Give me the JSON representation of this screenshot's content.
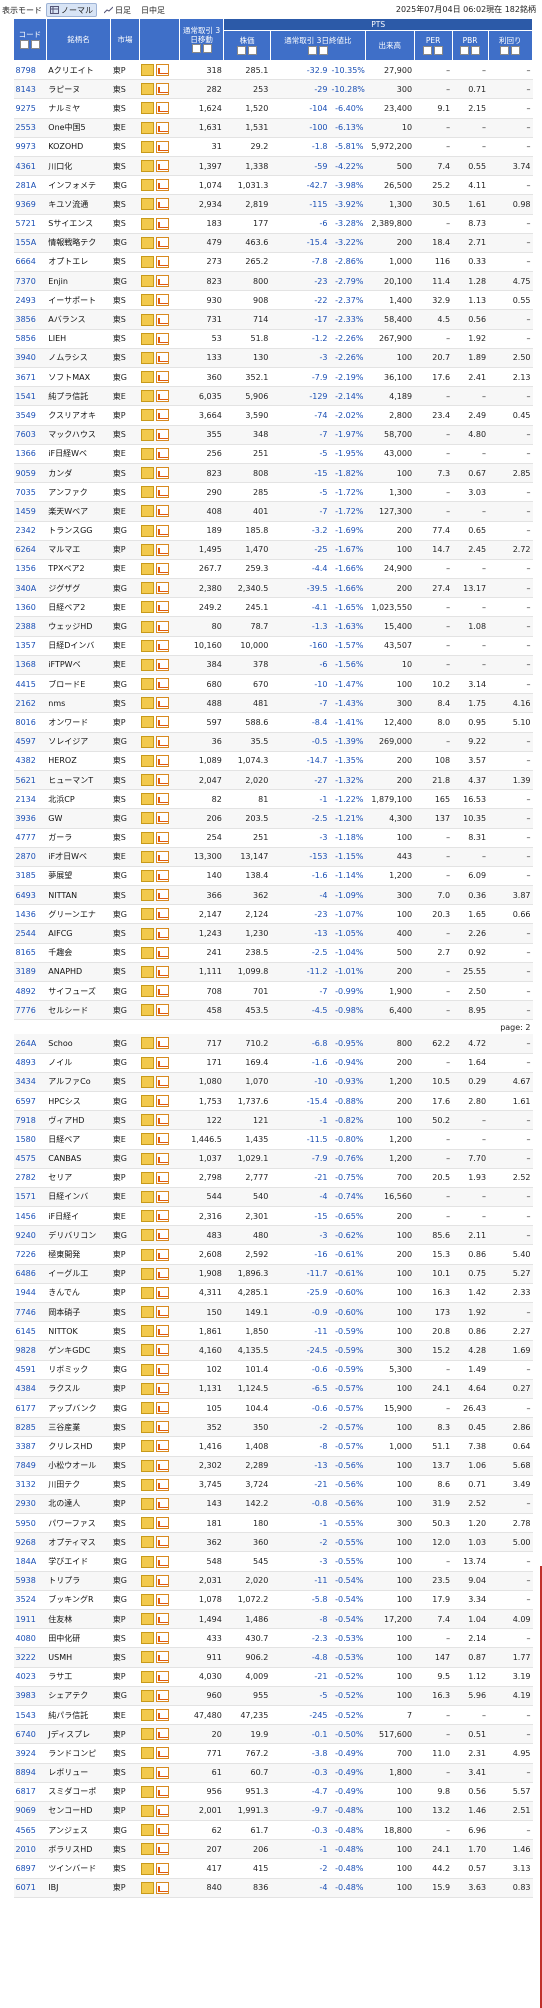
{
  "header": {
    "display_mode_label": "表示モード",
    "modes": [
      "ノーマル",
      "日足",
      "日中足"
    ],
    "datetime": "2025年07月04日 06:02現在 182銘柄"
  },
  "columns": {
    "code": "コード",
    "name": "銘柄名",
    "market": "市場",
    "vol3": "通常取引 3日移動",
    "price": "株価",
    "pts": "PTS",
    "ratio": "通常取引 3日終値比",
    "volume": "出来高",
    "per": "PER",
    "pbr": "PBR",
    "yield": "利回り"
  },
  "page_label": "page: 2",
  "rows": [
    [
      "8798",
      "Aクリエイト",
      "東P",
      "318",
      "285.1",
      "-32.9",
      "-10.35%",
      "27,900",
      "–",
      "–",
      "–"
    ],
    [
      "8143",
      "ラピーヌ",
      "東S",
      "282",
      "253",
      "-29",
      "-10.28%",
      "300",
      "–",
      "0.71",
      "–"
    ],
    [
      "9275",
      "ナルミヤ",
      "東S",
      "1,624",
      "1,520",
      "-104",
      "-6.40%",
      "23,400",
      "9.1",
      "2.15",
      "–"
    ],
    [
      "2553",
      "One中国5",
      "東E",
      "1,631",
      "1,531",
      "-100",
      "-6.13%",
      "10",
      "–",
      "–",
      "–"
    ],
    [
      "9973",
      "KOZOHD",
      "東S",
      "31",
      "29.2",
      "-1.8",
      "-5.81%",
      "5,972,200",
      "–",
      "–",
      "–"
    ],
    [
      "4361",
      "川口化",
      "東S",
      "1,397",
      "1,338",
      "-59",
      "-4.22%",
      "500",
      "7.4",
      "0.55",
      "3.74"
    ],
    [
      "281A",
      "インフォメテ",
      "東G",
      "1,074",
      "1,031.3",
      "-42.7",
      "-3.98%",
      "26,500",
      "25.2",
      "4.11",
      "–"
    ],
    [
      "9369",
      "キユソ流通",
      "東S",
      "2,934",
      "2,819",
      "-115",
      "-3.92%",
      "1,300",
      "30.5",
      "1.61",
      "0.98"
    ],
    [
      "5721",
      "Sサイエンス",
      "東S",
      "183",
      "177",
      "-6",
      "-3.28%",
      "2,389,800",
      "–",
      "8.73",
      "–"
    ],
    [
      "155A",
      "情報戦略テク",
      "東G",
      "479",
      "463.6",
      "-15.4",
      "-3.22%",
      "200",
      "18.4",
      "2.71",
      "–"
    ],
    [
      "6664",
      "オプトエレ",
      "東S",
      "273",
      "265.2",
      "-7.8",
      "-2.86%",
      "1,000",
      "116",
      "0.33",
      "–"
    ],
    [
      "7370",
      "Enjin",
      "東G",
      "823",
      "800",
      "-23",
      "-2.79%",
      "20,100",
      "11.4",
      "1.28",
      "4.75"
    ],
    [
      "2493",
      "イーサポート",
      "東S",
      "930",
      "908",
      "-22",
      "-2.37%",
      "1,400",
      "32.9",
      "1.13",
      "0.55"
    ],
    [
      "3856",
      "Aバランス",
      "東S",
      "731",
      "714",
      "-17",
      "-2.33%",
      "58,400",
      "4.5",
      "0.56",
      "–"
    ],
    [
      "5856",
      "LIEH",
      "東S",
      "53",
      "51.8",
      "-1.2",
      "-2.26%",
      "267,900",
      "–",
      "1.92",
      "–"
    ],
    [
      "3940",
      "ノムラシス",
      "東S",
      "133",
      "130",
      "-3",
      "-2.26%",
      "100",
      "20.7",
      "1.89",
      "2.50"
    ],
    [
      "3671",
      "ソフトMAX",
      "東G",
      "360",
      "352.1",
      "-7.9",
      "-2.19%",
      "36,100",
      "17.6",
      "2.41",
      "2.13"
    ],
    [
      "1541",
      "純プラ信託",
      "東E",
      "6,035",
      "5,906",
      "-129",
      "-2.14%",
      "4,189",
      "–",
      "–",
      "–"
    ],
    [
      "3549",
      "クスリアオキ",
      "東P",
      "3,664",
      "3,590",
      "-74",
      "-2.02%",
      "2,800",
      "23.4",
      "2.49",
      "0.45"
    ],
    [
      "7603",
      "マックハウス",
      "東S",
      "355",
      "348",
      "-7",
      "-1.97%",
      "58,700",
      "–",
      "4.80",
      "–"
    ],
    [
      "1366",
      "iF日経Wベ",
      "東E",
      "256",
      "251",
      "-5",
      "-1.95%",
      "43,000",
      "–",
      "–",
      "–"
    ],
    [
      "9059",
      "カンダ",
      "東S",
      "823",
      "808",
      "-15",
      "-1.82%",
      "100",
      "7.3",
      "0.67",
      "2.85"
    ],
    [
      "7035",
      "アンファク",
      "東S",
      "290",
      "285",
      "-5",
      "-1.72%",
      "1,300",
      "–",
      "3.03",
      "–"
    ],
    [
      "1459",
      "楽天Wベア",
      "東E",
      "408",
      "401",
      "-7",
      "-1.72%",
      "127,300",
      "–",
      "–",
      "–"
    ],
    [
      "2342",
      "トランスGG",
      "東G",
      "189",
      "185.8",
      "-3.2",
      "-1.69%",
      "200",
      "77.4",
      "0.65",
      "–"
    ],
    [
      "6264",
      "マルマエ",
      "東P",
      "1,495",
      "1,470",
      "-25",
      "-1.67%",
      "100",
      "14.7",
      "2.45",
      "2.72"
    ],
    [
      "1356",
      "TPXベア2",
      "東E",
      "267.7",
      "259.3",
      "-4.4",
      "-1.66%",
      "24,900",
      "–",
      "–",
      "–"
    ],
    [
      "340A",
      "ジグザグ",
      "東G",
      "2,380",
      "2,340.5",
      "-39.5",
      "-1.66%",
      "200",
      "27.4",
      "13.17",
      "–"
    ],
    [
      "1360",
      "日経ベア2",
      "東E",
      "249.2",
      "245.1",
      "-4.1",
      "-1.65%",
      "1,023,550",
      "–",
      "–",
      "–"
    ],
    [
      "2388",
      "ウェッジHD",
      "東G",
      "80",
      "78.7",
      "-1.3",
      "-1.63%",
      "15,400",
      "–",
      "1.08",
      "–"
    ],
    [
      "1357",
      "日経Dインバ",
      "東E",
      "10,160",
      "10,000",
      "-160",
      "-1.57%",
      "43,507",
      "–",
      "–",
      "–"
    ],
    [
      "1368",
      "iFTPWベ",
      "東E",
      "384",
      "378",
      "-6",
      "-1.56%",
      "10",
      "–",
      "–",
      "–"
    ],
    [
      "4415",
      "ブロードE",
      "東G",
      "680",
      "670",
      "-10",
      "-1.47%",
      "100",
      "10.2",
      "3.14",
      "–"
    ],
    [
      "2162",
      "nms",
      "東S",
      "488",
      "481",
      "-7",
      "-1.43%",
      "300",
      "8.4",
      "1.75",
      "4.16"
    ],
    [
      "8016",
      "オンワード",
      "東P",
      "597",
      "588.6",
      "-8.4",
      "-1.41%",
      "12,400",
      "8.0",
      "0.95",
      "5.10"
    ],
    [
      "4597",
      "ソレイジア",
      "東G",
      "36",
      "35.5",
      "-0.5",
      "-1.39%",
      "269,000",
      "–",
      "9.22",
      "–"
    ],
    [
      "4382",
      "HEROZ",
      "東S",
      "1,089",
      "1,074.3",
      "-14.7",
      "-1.35%",
      "200",
      "108",
      "3.57",
      "–"
    ],
    [
      "5621",
      "ヒューマンT",
      "東S",
      "2,047",
      "2,020",
      "-27",
      "-1.32%",
      "200",
      "21.8",
      "4.37",
      "1.39"
    ],
    [
      "2134",
      "北浜CP",
      "東S",
      "82",
      "81",
      "-1",
      "-1.22%",
      "1,879,100",
      "165",
      "16.53",
      "–"
    ],
    [
      "3936",
      "GW",
      "東G",
      "206",
      "203.5",
      "-2.5",
      "-1.21%",
      "4,300",
      "137",
      "10.35",
      "–"
    ],
    [
      "4777",
      "ガーラ",
      "東S",
      "254",
      "251",
      "-3",
      "-1.18%",
      "100",
      "–",
      "8.31",
      "–"
    ],
    [
      "2870",
      "iF才日Wベ",
      "東E",
      "13,300",
      "13,147",
      "-153",
      "-1.15%",
      "443",
      "–",
      "–",
      "–"
    ],
    [
      "3185",
      "夢展望",
      "東G",
      "140",
      "138.4",
      "-1.6",
      "-1.14%",
      "1,200",
      "–",
      "6.09",
      "–"
    ],
    [
      "6493",
      "NITTAN",
      "東S",
      "366",
      "362",
      "-4",
      "-1.09%",
      "300",
      "7.0",
      "0.36",
      "3.87"
    ],
    [
      "1436",
      "グリーンエナ",
      "東G",
      "2,147",
      "2,124",
      "-23",
      "-1.07%",
      "100",
      "20.3",
      "1.65",
      "0.66"
    ],
    [
      "2544",
      "AIFCG",
      "東S",
      "1,243",
      "1,230",
      "-13",
      "-1.05%",
      "400",
      "–",
      "2.26",
      "–"
    ],
    [
      "8165",
      "千趣会",
      "東S",
      "241",
      "238.5",
      "-2.5",
      "-1.04%",
      "500",
      "2.7",
      "0.92",
      "–"
    ],
    [
      "3189",
      "ANAPHD",
      "東S",
      "1,111",
      "1,099.8",
      "-11.2",
      "-1.01%",
      "200",
      "–",
      "25.55",
      "–"
    ],
    [
      "4892",
      "サイフューズ",
      "東G",
      "708",
      "701",
      "-7",
      "-0.99%",
      "1,900",
      "–",
      "2.50",
      "–"
    ],
    [
      "7776",
      "セルシード",
      "東G",
      "458",
      "453.5",
      "-4.5",
      "-0.98%",
      "6,400",
      "–",
      "8.95",
      "–"
    ],
    "PAGE",
    [
      "264A",
      "Schoo",
      "東G",
      "717",
      "710.2",
      "-6.8",
      "-0.95%",
      "800",
      "62.2",
      "4.72",
      "–"
    ],
    [
      "4893",
      "ノイル",
      "東G",
      "171",
      "169.4",
      "-1.6",
      "-0.94%",
      "200",
      "–",
      "1.64",
      "–"
    ],
    [
      "3434",
      "アルファCo",
      "東S",
      "1,080",
      "1,070",
      "-10",
      "-0.93%",
      "1,200",
      "10.5",
      "0.29",
      "4.67"
    ],
    [
      "6597",
      "HPCシス",
      "東G",
      "1,753",
      "1,737.6",
      "-15.4",
      "-0.88%",
      "200",
      "17.6",
      "2.80",
      "1.61"
    ],
    [
      "7918",
      "ヴィアHD",
      "東S",
      "122",
      "121",
      "-1",
      "-0.82%",
      "100",
      "50.2",
      "–",
      "–"
    ],
    [
      "1580",
      "日経ベア",
      "東E",
      "1,446.5",
      "1,435",
      "-11.5",
      "-0.80%",
      "1,200",
      "–",
      "–",
      "–"
    ],
    [
      "4575",
      "CANBAS",
      "東G",
      "1,037",
      "1,029.1",
      "-7.9",
      "-0.76%",
      "1,200",
      "–",
      "7.70",
      "–"
    ],
    [
      "2782",
      "セリア",
      "東P",
      "2,798",
      "2,777",
      "-21",
      "-0.75%",
      "700",
      "20.5",
      "1.93",
      "2.52"
    ],
    [
      "1571",
      "日経インバ",
      "東E",
      "544",
      "540",
      "-4",
      "-0.74%",
      "16,560",
      "–",
      "–",
      "–"
    ],
    [
      "1456",
      "iF日経イ",
      "東E",
      "2,316",
      "2,301",
      "-15",
      "-0.65%",
      "200",
      "–",
      "–",
      "–"
    ],
    [
      "9240",
      "デリバリコン",
      "東G",
      "483",
      "480",
      "-3",
      "-0.62%",
      "100",
      "85.6",
      "2.11",
      "–"
    ],
    [
      "7226",
      "極東開発",
      "東P",
      "2,608",
      "2,592",
      "-16",
      "-0.61%",
      "200",
      "15.3",
      "0.86",
      "5.40"
    ],
    [
      "6486",
      "イーグル工",
      "東P",
      "1,908",
      "1,896.3",
      "-11.7",
      "-0.61%",
      "100",
      "10.1",
      "0.75",
      "5.27"
    ],
    [
      "1944",
      "きんでん",
      "東P",
      "4,311",
      "4,285.1",
      "-25.9",
      "-0.60%",
      "100",
      "16.3",
      "1.42",
      "2.33"
    ],
    [
      "7746",
      "岡本硝子",
      "東S",
      "150",
      "149.1",
      "-0.9",
      "-0.60%",
      "100",
      "173",
      "1.92",
      "–"
    ],
    [
      "6145",
      "NITTOK",
      "東S",
      "1,861",
      "1,850",
      "-11",
      "-0.59%",
      "100",
      "20.8",
      "0.86",
      "2.27"
    ],
    [
      "9828",
      "ゲンキGDC",
      "東S",
      "4,160",
      "4,135.5",
      "-24.5",
      "-0.59%",
      "300",
      "15.2",
      "4.28",
      "1.69"
    ],
    [
      "4591",
      "リボミック",
      "東G",
      "102",
      "101.4",
      "-0.6",
      "-0.59%",
      "5,300",
      "–",
      "1.49",
      "–"
    ],
    [
      "4384",
      "ラクスル",
      "東P",
      "1,131",
      "1,124.5",
      "-6.5",
      "-0.57%",
      "100",
      "24.1",
      "4.64",
      "0.27"
    ],
    [
      "6177",
      "アップバンク",
      "東G",
      "105",
      "104.4",
      "-0.6",
      "-0.57%",
      "15,900",
      "–",
      "26.43",
      "–"
    ],
    [
      "8285",
      "三谷産業",
      "東S",
      "352",
      "350",
      "-2",
      "-0.57%",
      "100",
      "8.3",
      "0.45",
      "2.86"
    ],
    [
      "3387",
      "クリレスHD",
      "東P",
      "1,416",
      "1,408",
      "-8",
      "-0.57%",
      "1,000",
      "51.1",
      "7.38",
      "0.64"
    ],
    [
      "7849",
      "小松ウオール",
      "東S",
      "2,302",
      "2,289",
      "-13",
      "-0.56%",
      "100",
      "13.7",
      "1.06",
      "5.68"
    ],
    [
      "3132",
      "川田テク",
      "東S",
      "3,745",
      "3,724",
      "-21",
      "-0.56%",
      "100",
      "8.6",
      "0.71",
      "3.49"
    ],
    [
      "2930",
      "北の達人",
      "東P",
      "143",
      "142.2",
      "-0.8",
      "-0.56%",
      "100",
      "31.9",
      "2.52",
      "–"
    ],
    [
      "5950",
      "パワーファス",
      "東S",
      "181",
      "180",
      "-1",
      "-0.55%",
      "300",
      "50.3",
      "1.20",
      "2.78"
    ],
    [
      "9268",
      "オプティマス",
      "東S",
      "362",
      "360",
      "-2",
      "-0.55%",
      "100",
      "12.0",
      "1.03",
      "5.00"
    ],
    [
      "184A",
      "学びエイド",
      "東G",
      "548",
      "545",
      "-3",
      "-0.55%",
      "100",
      "–",
      "13.74",
      "–"
    ],
    [
      "5938",
      "トリプラ",
      "東G",
      "2,031",
      "2,020",
      "-11",
      "-0.54%",
      "100",
      "23.5",
      "9.04",
      "–"
    ],
    [
      "3524",
      "ブッキングR",
      "東G",
      "1,078",
      "1,072.2",
      "-5.8",
      "-0.54%",
      "100",
      "17.9",
      "3.34",
      "–"
    ],
    [
      "1911",
      "住友林",
      "東P",
      "1,494",
      "1,486",
      "-8",
      "-0.54%",
      "17,200",
      "7.4",
      "1.04",
      "4.09"
    ],
    [
      "4080",
      "田中化研",
      "東S",
      "433",
      "430.7",
      "-2.3",
      "-0.53%",
      "100",
      "–",
      "2.14",
      "–"
    ],
    [
      "3222",
      "USMH",
      "東S",
      "911",
      "906.2",
      "-4.8",
      "-0.53%",
      "100",
      "147",
      "0.87",
      "1.77"
    ],
    [
      "4023",
      "ラサ工",
      "東P",
      "4,030",
      "4,009",
      "-21",
      "-0.52%",
      "100",
      "9.5",
      "1.12",
      "3.19"
    ],
    [
      "3983",
      "シェアテク",
      "東G",
      "960",
      "955",
      "-5",
      "-0.52%",
      "100",
      "16.3",
      "5.96",
      "4.19"
    ],
    [
      "1543",
      "純パラ信託",
      "東E",
      "47,480",
      "47,235",
      "-245",
      "-0.52%",
      "7",
      "–",
      "–",
      "–"
    ],
    [
      "6740",
      "Jディスプレ",
      "東P",
      "20",
      "19.9",
      "-0.1",
      "-0.50%",
      "517,600",
      "–",
      "0.51",
      "–"
    ],
    [
      "3924",
      "ランドコンピ",
      "東S",
      "771",
      "767.2",
      "-3.8",
      "-0.49%",
      "700",
      "11.0",
      "2.31",
      "4.95"
    ],
    [
      "8894",
      "レボリュー",
      "東S",
      "61",
      "60.7",
      "-0.3",
      "-0.49%",
      "1,800",
      "–",
      "3.41",
      "–"
    ],
    [
      "6817",
      "スミダコーポ",
      "東P",
      "956",
      "951.3",
      "-4.7",
      "-0.49%",
      "100",
      "9.8",
      "0.56",
      "5.57"
    ],
    [
      "9069",
      "センコーHD",
      "東P",
      "2,001",
      "1,991.3",
      "-9.7",
      "-0.48%",
      "100",
      "13.2",
      "1.46",
      "2.51"
    ],
    [
      "4565",
      "アンジェス",
      "東G",
      "62",
      "61.7",
      "-0.3",
      "-0.48%",
      "18,800",
      "–",
      "6.96",
      "–"
    ],
    [
      "2010",
      "ボラリスHD",
      "東S",
      "207",
      "206",
      "-1",
      "-0.48%",
      "100",
      "24.1",
      "1.70",
      "1.46"
    ],
    [
      "6897",
      "ツインバード",
      "東S",
      "417",
      "415",
      "-2",
      "-0.48%",
      "100",
      "44.2",
      "0.57",
      "3.13"
    ],
    [
      "6071",
      "IBJ",
      "東P",
      "840",
      "836",
      "-4",
      "-0.48%",
      "100",
      "15.9",
      "3.63",
      "0.83"
    ]
  ]
}
